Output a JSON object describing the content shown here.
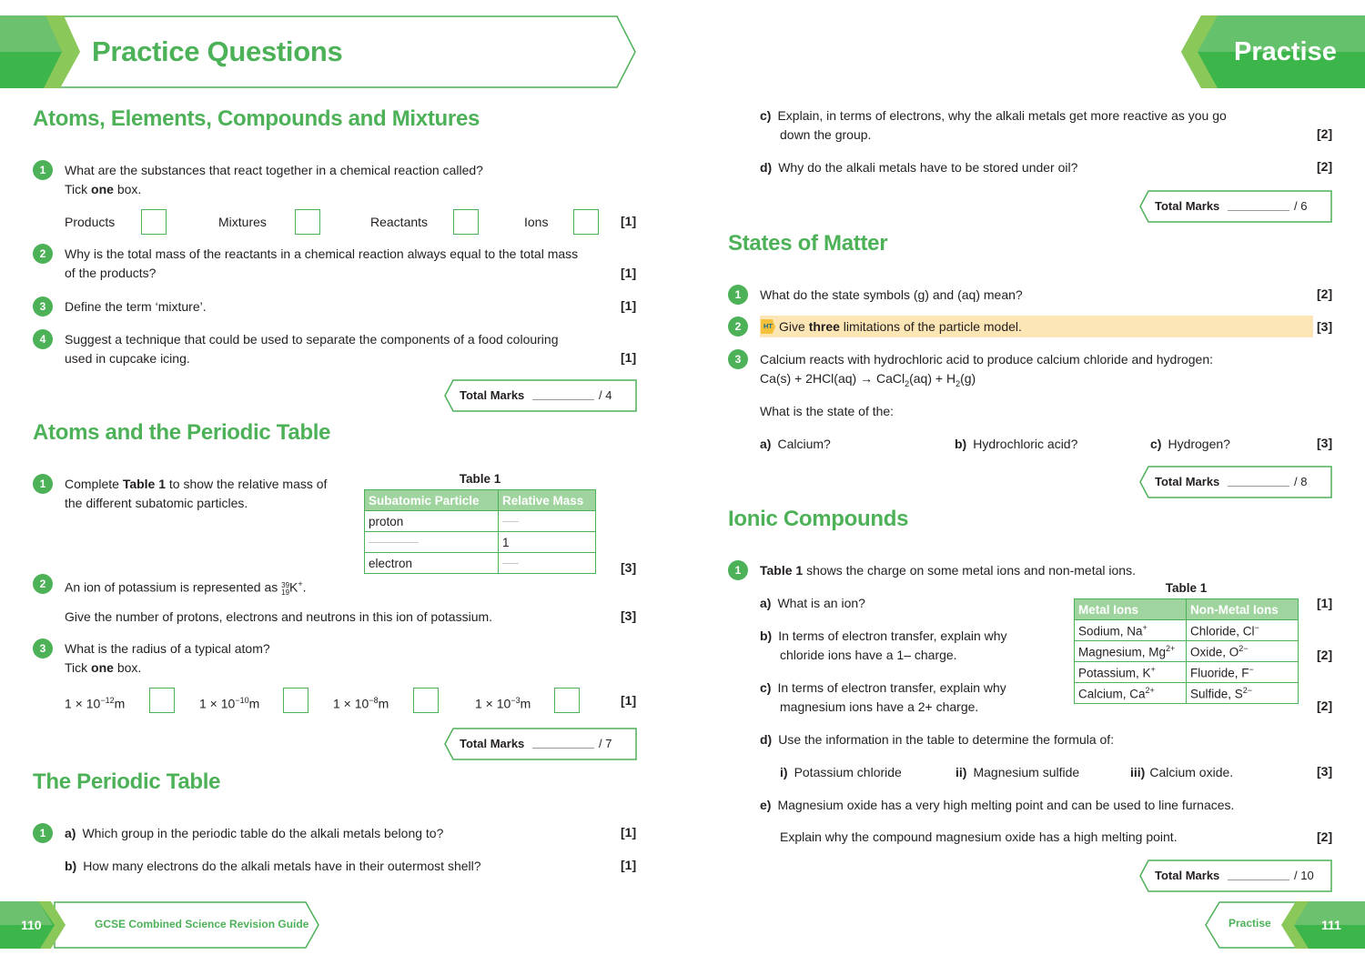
{
  "header": {
    "left_title": "Practice Questions",
    "right_title": "Practise"
  },
  "footer": {
    "left_page": "110",
    "left_label": "GCSE Combined Science Revision Guide",
    "right_label": "Practise",
    "right_page": "111"
  },
  "colors": {
    "brand_green": "#4db158",
    "light_green": "#9fd49e",
    "highlight": "#fde6b5",
    "ht_badge": "#f5c13c"
  },
  "sections": {
    "aecm": {
      "title": "Atoms, Elements, Compounds and Mixtures",
      "q1": {
        "num": "1",
        "text": "What are the substances that react together in a chemical reaction called?",
        "tick_prefix": "Tick ",
        "tick_bold": "one",
        "tick_suffix": " box.",
        "options": [
          "Products",
          "Mixtures",
          "Reactants",
          "Ions"
        ],
        "mark": "[1]"
      },
      "q2": {
        "num": "2",
        "line1": "Why is the total mass of the reactants in a chemical reaction always equal to the total mass",
        "line2": "of the products?",
        "mark": "[1]"
      },
      "q3": {
        "num": "3",
        "text": "Define the term ‘mixture’.",
        "mark": "[1]"
      },
      "q4": {
        "num": "4",
        "line1": "Suggest a technique that could be used to separate the components of a food colouring",
        "line2": "used in cupcake icing.",
        "mark": "[1]"
      },
      "total": {
        "label": "Total Marks",
        "out_of": "/ 4"
      }
    },
    "apt": {
      "title": "Atoms and the Periodic Table",
      "q1": {
        "num": "1",
        "pre": "Complete ",
        "bold": "Table 1",
        "post": " to show the relative mass of",
        "line2": "the different subatomic particles.",
        "mark": "[3]"
      },
      "table": {
        "caption": "Table 1",
        "headers": [
          "Subatomic Particle",
          "Relative Mass"
        ],
        "rows": [
          [
            "proton",
            ""
          ],
          [
            "",
            "1"
          ],
          [
            "electron",
            ""
          ]
        ]
      },
      "q2": {
        "num": "2",
        "text": "An ion of potassium is represented as ",
        "mass_number": "39",
        "atomic_number": "19",
        "symbol": "K",
        "charge": "+",
        "end": ".",
        "line2": "Give the number of protons, electrons and neutrons in this ion of potassium.",
        "mark": "[3]"
      },
      "q3": {
        "num": "3",
        "text": "What is the radius of a typical atom?",
        "tick_prefix": "Tick ",
        "tick_bold": "one",
        "tick_suffix": " box.",
        "options": [
          {
            "base": "1 × 10",
            "exp": "−12",
            "unit": "m"
          },
          {
            "base": "1 × 10",
            "exp": "−10",
            "unit": "m"
          },
          {
            "base": "1 × 10",
            "exp": "−8",
            "unit": "m"
          },
          {
            "base": "1 × 10",
            "exp": "−3",
            "unit": "m"
          }
        ],
        "mark": "[1]"
      },
      "total": {
        "label": "Total Marks",
        "out_of": "/ 7"
      }
    },
    "pt": {
      "title": "The Periodic Table",
      "q1": {
        "num": "1",
        "a": {
          "letter": "a)",
          "text": "Which group in the periodic table do the alkali metals belong to?",
          "mark": "[1]"
        },
        "b": {
          "letter": "b)",
          "text": "How many electrons do the alkali metals have in their outermost shell?",
          "mark": "[1]"
        },
        "c": {
          "letter": "c)",
          "line1": "Explain, in terms of electrons, why the alkali metals get more reactive as you go",
          "line2": "down the group.",
          "mark": "[2]"
        },
        "d": {
          "letter": "d)",
          "text": "Why do the alkali metals have to be stored under oil?",
          "mark": "[2]"
        }
      },
      "total": {
        "label": "Total Marks",
        "out_of": "/ 6"
      }
    },
    "som": {
      "title": "States of Matter",
      "q1": {
        "num": "1",
        "text": "What do the state symbols (g) and (aq) mean?",
        "mark": "[2]"
      },
      "q2": {
        "num": "2",
        "badge": "HT",
        "pre": "Give ",
        "bold": "three",
        "post": " limitations of the particle model.",
        "mark": "[3]"
      },
      "q3": {
        "num": "3",
        "text": "Calcium reacts with hydrochloric acid to produce calcium chloride and hydrogen:",
        "eq_a": "Ca(s) + 2HCl(aq) → CaCl",
        "eq_sub1": "2",
        "eq_b": "(aq) + H",
        "eq_sub2": "2",
        "eq_c": "(g)",
        "prompt": "What is the state of the:",
        "parts": [
          {
            "letter": "a)",
            "text": "Calcium?"
          },
          {
            "letter": "b)",
            "text": "Hydrochloric acid?"
          },
          {
            "letter": "c)",
            "text": "Hydrogen?"
          }
        ],
        "mark": "[3]"
      },
      "total": {
        "label": "Total Marks",
        "out_of": "/ 8"
      }
    },
    "ic": {
      "title": "Ionic Compounds",
      "q1": {
        "num": "1",
        "bold": "Table 1",
        "post": " shows the charge on some metal ions and non-metal ions.",
        "a": {
          "letter": "a)",
          "text": "What is an ion?",
          "mark": "[1]"
        },
        "b": {
          "letter": "b)",
          "line1": "In terms of electron transfer, explain why",
          "line2": "chloride ions have a 1– charge.",
          "mark": "[2]"
        },
        "c": {
          "letter": "c)",
          "line1": "In terms of electron transfer, explain why",
          "line2": "magnesium ions have a 2+ charge.",
          "mark": "[2]"
        },
        "d": {
          "letter": "d)",
          "text": "Use the information in the table to determine the formula of:",
          "parts": [
            {
              "letter": "i)",
              "text": "Potassium chloride"
            },
            {
              "letter": "ii)",
              "text": "Magnesium sulfide"
            },
            {
              "letter": "iii)",
              "text": "Calcium oxide."
            }
          ],
          "mark": "[3]"
        },
        "e": {
          "letter": "e)",
          "line1": "Magnesium oxide has a very high melting point and can be used to line furnaces.",
          "line2": "Explain why the compound magnesium oxide has a high melting point.",
          "mark": "[2]"
        }
      },
      "table": {
        "caption": "Table 1",
        "headers": [
          "Metal Ions",
          "Non-Metal Ions"
        ],
        "rows": [
          [
            {
              "name": "Sodium, Na",
              "charge": "+"
            },
            {
              "name": "Chloride, Cl",
              "charge": "−"
            }
          ],
          [
            {
              "name": "Magnesium, Mg",
              "charge": "2+"
            },
            {
              "name": "Oxide, O",
              "charge": "2−"
            }
          ],
          [
            {
              "name": "Potassium, K",
              "charge": "+"
            },
            {
              "name": "Fluoride, F",
              "charge": "−"
            }
          ],
          [
            {
              "name": "Calcium, Ca",
              "charge": "2+"
            },
            {
              "name": "Sulfide, S",
              "charge": "2−"
            }
          ]
        ]
      },
      "total": {
        "label": "Total Marks",
        "out_of": "/ 10"
      }
    }
  }
}
